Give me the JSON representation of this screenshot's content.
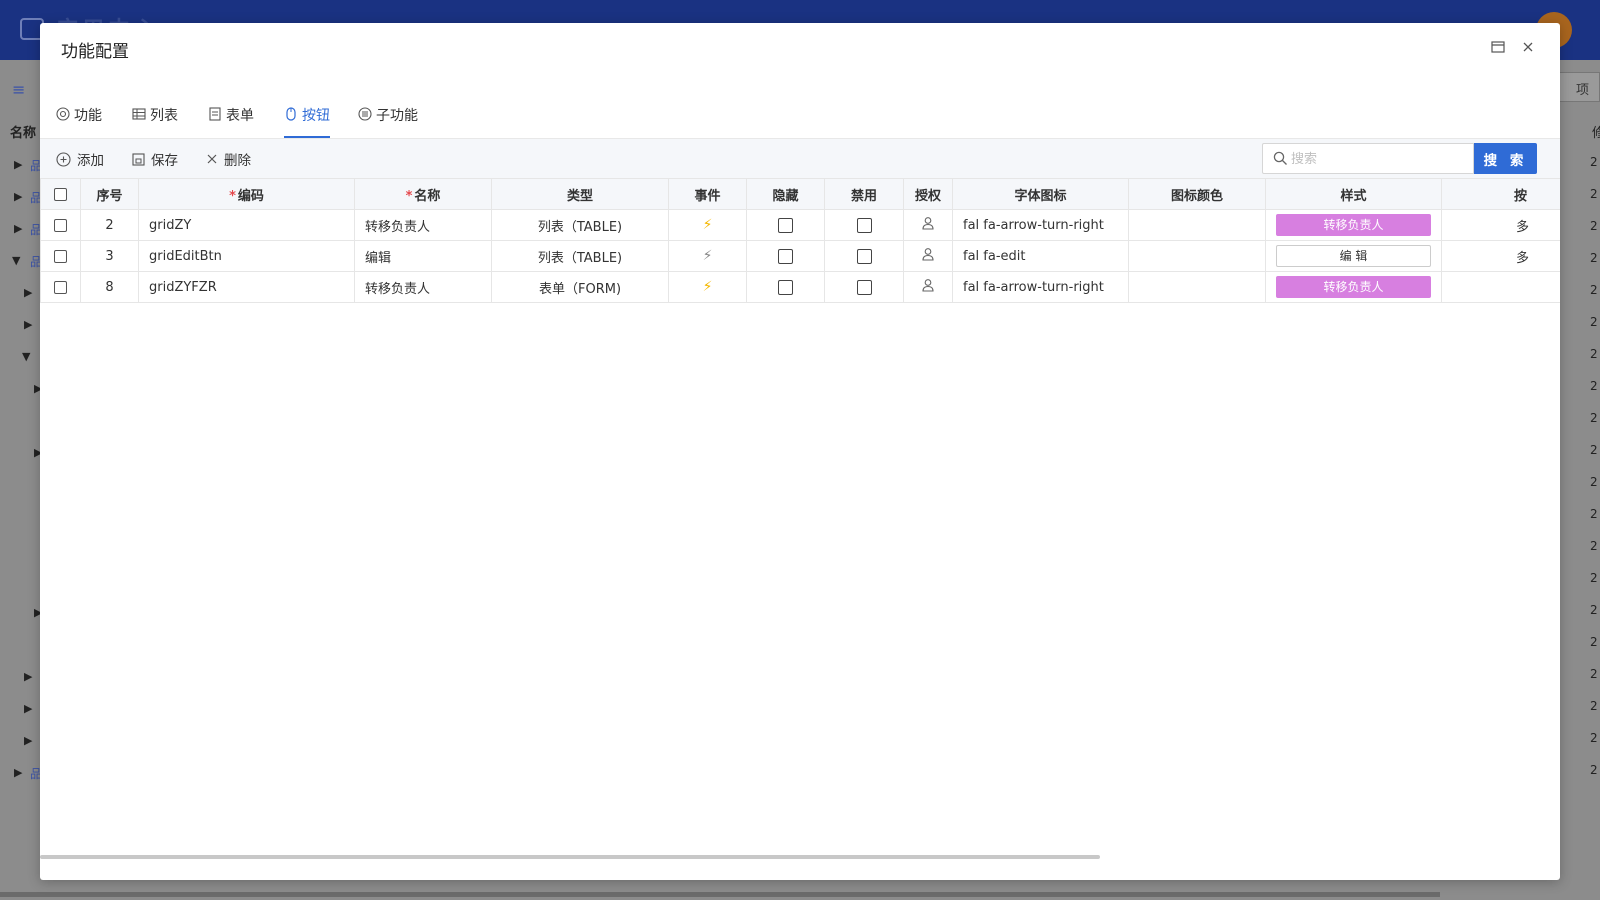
{
  "background": {
    "app_title": "应用中心",
    "name_col": "名称",
    "right_btn": "项",
    "right_col": "修",
    "right_num": "2"
  },
  "modal": {
    "title": "功能配置",
    "tabs": [
      {
        "label": "功能",
        "icon": "target-icon"
      },
      {
        "label": "列表",
        "icon": "table-icon"
      },
      {
        "label": "表单",
        "icon": "form-icon"
      },
      {
        "label": "按钮",
        "icon": "mouse-icon",
        "active": true
      },
      {
        "label": "子功能",
        "icon": "list-circle-icon"
      }
    ],
    "toolbar": {
      "add_label": "添加",
      "save_label": "保存",
      "delete_label": "删除",
      "search_placeholder": "搜索",
      "search_button": "搜 索"
    },
    "columns": [
      "序号",
      "编码",
      "名称",
      "类型",
      "事件",
      "隐藏",
      "禁用",
      "授权",
      "字体图标",
      "图标颜色",
      "样式",
      "按"
    ],
    "rows": [
      {
        "seq": "2",
        "code": "gridZY",
        "name": "转移负责人",
        "type": "列表（TABLE)",
        "event_color": "#f5b800",
        "icon": "fal fa-arrow-turn-right",
        "icon_color": "",
        "style_label": "转移负责人",
        "style": "purple",
        "extra": "多"
      },
      {
        "seq": "3",
        "code": "gridEditBtn",
        "name": "编辑",
        "type": "列表（TABLE)",
        "event_color": "#888888",
        "icon": "fal fa-edit",
        "icon_color": "",
        "style_label": "编 辑",
        "style": "white",
        "extra": "多"
      },
      {
        "seq": "8",
        "code": "gridZYFZR",
        "name": "转移负责人",
        "type": "表单（FORM)",
        "event_color": "#f5b800",
        "icon": "fal fa-arrow-turn-right",
        "icon_color": "",
        "style_label": "转移负责人",
        "style": "purple",
        "extra": ""
      }
    ]
  },
  "colors": {
    "accent": "#2f6bd6",
    "style_purple": "#d77fe0",
    "required": "#e5484d",
    "top_bar": "#1a3282"
  }
}
